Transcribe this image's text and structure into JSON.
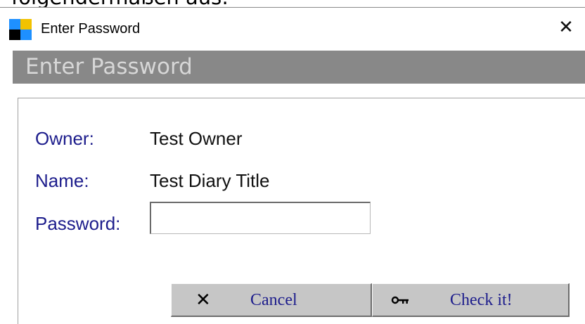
{
  "background": {
    "partial_text": "folgendermaßen aus:"
  },
  "window": {
    "title": "Enter Password",
    "close_glyph": "✕",
    "app_icon": "app-icon"
  },
  "header": {
    "title": "Enter Password"
  },
  "fields": {
    "owner_label": "Owner:",
    "owner_value": "Test Owner",
    "name_label": "Name:",
    "name_value": "Test Diary Title",
    "password_label": "Password:",
    "password_value": "",
    "password_placeholder": ""
  },
  "buttons": {
    "cancel": {
      "label": "Cancel",
      "icon": "cross-icon",
      "glyph": "✕"
    },
    "check": {
      "label": "Check it!",
      "icon": "key-icon"
    }
  },
  "colors": {
    "header_bar": "#888888",
    "header_text": "#d7d7d7",
    "label_text": "#1d1d8c",
    "button_face": "#c6c6c6",
    "icon_blue": "#1e90ff",
    "icon_yellow": "#f2c200",
    "icon_black": "#000000"
  }
}
